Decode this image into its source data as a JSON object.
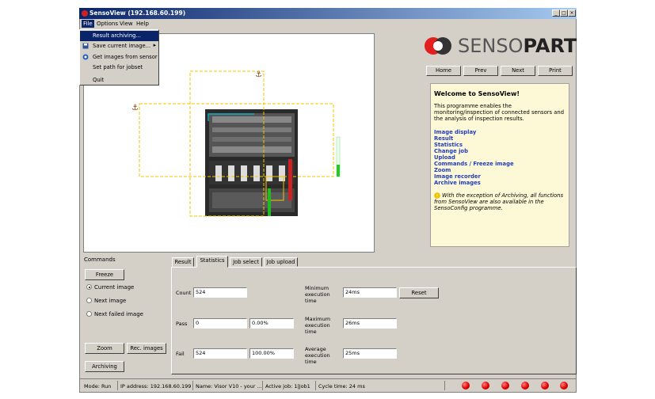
{
  "window": {
    "title": "SensoView (192.168.60.199)",
    "min": "_",
    "max": "□",
    "close": "×"
  },
  "menu": {
    "file": "File",
    "options": "Options",
    "view": "View",
    "help": "Help"
  },
  "file_menu": [
    {
      "label": "Result archiving...",
      "icon": "",
      "selected": true
    },
    {
      "label": "Save current image...",
      "icon": "save-icon",
      "arrow": "▸"
    },
    {
      "label": "Get images from sensor",
      "icon": "sensor-icon"
    },
    {
      "label": "Set path for jobset",
      "icon": ""
    },
    {
      "label": "Quit",
      "icon": ""
    }
  ],
  "logo": {
    "part1": "SENSO",
    "part2": "PART"
  },
  "nav": {
    "home": "Home",
    "prev": "Prev",
    "next": "Next",
    "print": "Print"
  },
  "help": {
    "title": "Welcome to SensoView!",
    "body": "This programme enables the monitoring/inspection of connected sensors and the analysis of inspection results.",
    "links": [
      "Image display",
      "Result",
      "Statistics",
      "Change job",
      "Upload",
      "Commands / Freeze image",
      "Zoom",
      "Image recorder",
      "Archive images"
    ],
    "note": "With the exception of Archiving, all functions from SensoView are also available in the SensoConfig programme."
  },
  "commands": {
    "title": "Commands",
    "freeze": "Freeze",
    "radio_current": "Current image",
    "radio_next": "Next image",
    "radio_failed": "Next failed image",
    "zoom": "Zoom",
    "rec_images": "Rec. images",
    "archiving": "Archiving"
  },
  "tabs": [
    "Result",
    "Statistics",
    "Job select",
    "Job upload"
  ],
  "statistics": {
    "count_label": "Count",
    "count": "524",
    "pass_label": "Pass",
    "pass": "0",
    "pass_pct": "0.00%",
    "fail_label": "Fail",
    "fail": "524",
    "fail_pct": "100.00%",
    "min_label": "Minimum execution time",
    "min": "24ms",
    "max_label": "Maximum execution time",
    "max": "26ms",
    "avg_label": "Average execution time",
    "avg": "25ms",
    "reset": "Reset"
  },
  "status": {
    "mode": "Mode:  Run",
    "ip": "IP address:  192.168.60.199",
    "name": "Name:  Visor V10 - your ...",
    "job": "Active job:  1|Job1",
    "cycle": "Cycle time:   24 ms"
  },
  "colors": {
    "title_start": "#0a246a",
    "title_end": "#a6caf0",
    "help_bg": "#fdf8d6",
    "link": "#1f3cc4",
    "roi": "#f5c400",
    "led": "#e00000"
  }
}
